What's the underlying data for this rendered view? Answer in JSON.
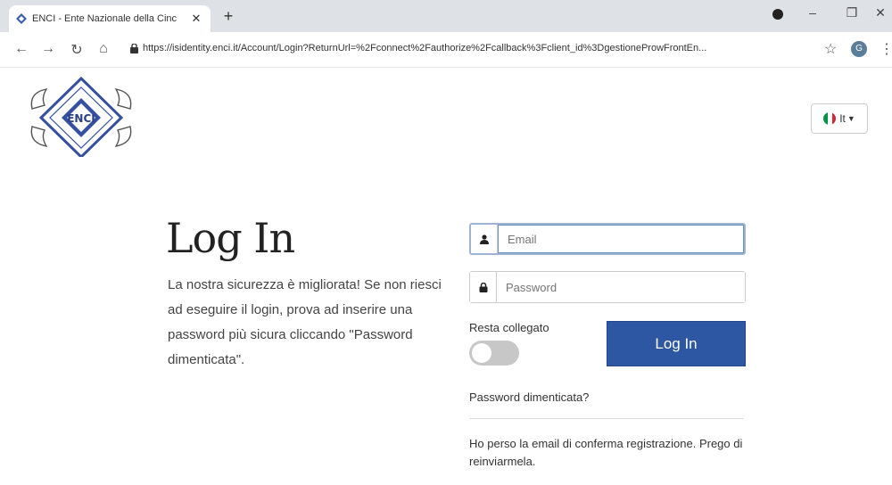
{
  "browser": {
    "tab_title": "ENCI - Ente Nazionale della Cinc",
    "tab_close": "✕",
    "new_tab": "+",
    "url": "https://isidentity.enci.it/Account/Login?ReturnUrl=%2Fconnect%2Fauthorize%2Fcallback%3Fclient_id%3DgestioneProwFrontEn...",
    "profile_initial": "G"
  },
  "logo": {
    "text": "ENCI",
    "icon": "enci-seal-logo"
  },
  "language": {
    "label": "It",
    "flag_colors": [
      "#009246",
      "#ffffff",
      "#ce2b37"
    ]
  },
  "login": {
    "title": "Log In",
    "intro": "La nostra sicurezza è migliorata! Se non riesci ad eseguire il login, prova ad inserire una password più sicura cliccando \"Password dimenticata\".",
    "email_placeholder": "Email",
    "password_placeholder": "Password",
    "remember_label": "Resta collegato",
    "remember_checked": false,
    "submit_label": "Log In",
    "forgot_link": "Password dimenticata?",
    "lost_email_link": "Ho perso la email di conferma registrazione. Prego di reinviarmela."
  },
  "colors": {
    "primary_button": "#2e57a3",
    "toggle_off": "#c7c7c7"
  }
}
